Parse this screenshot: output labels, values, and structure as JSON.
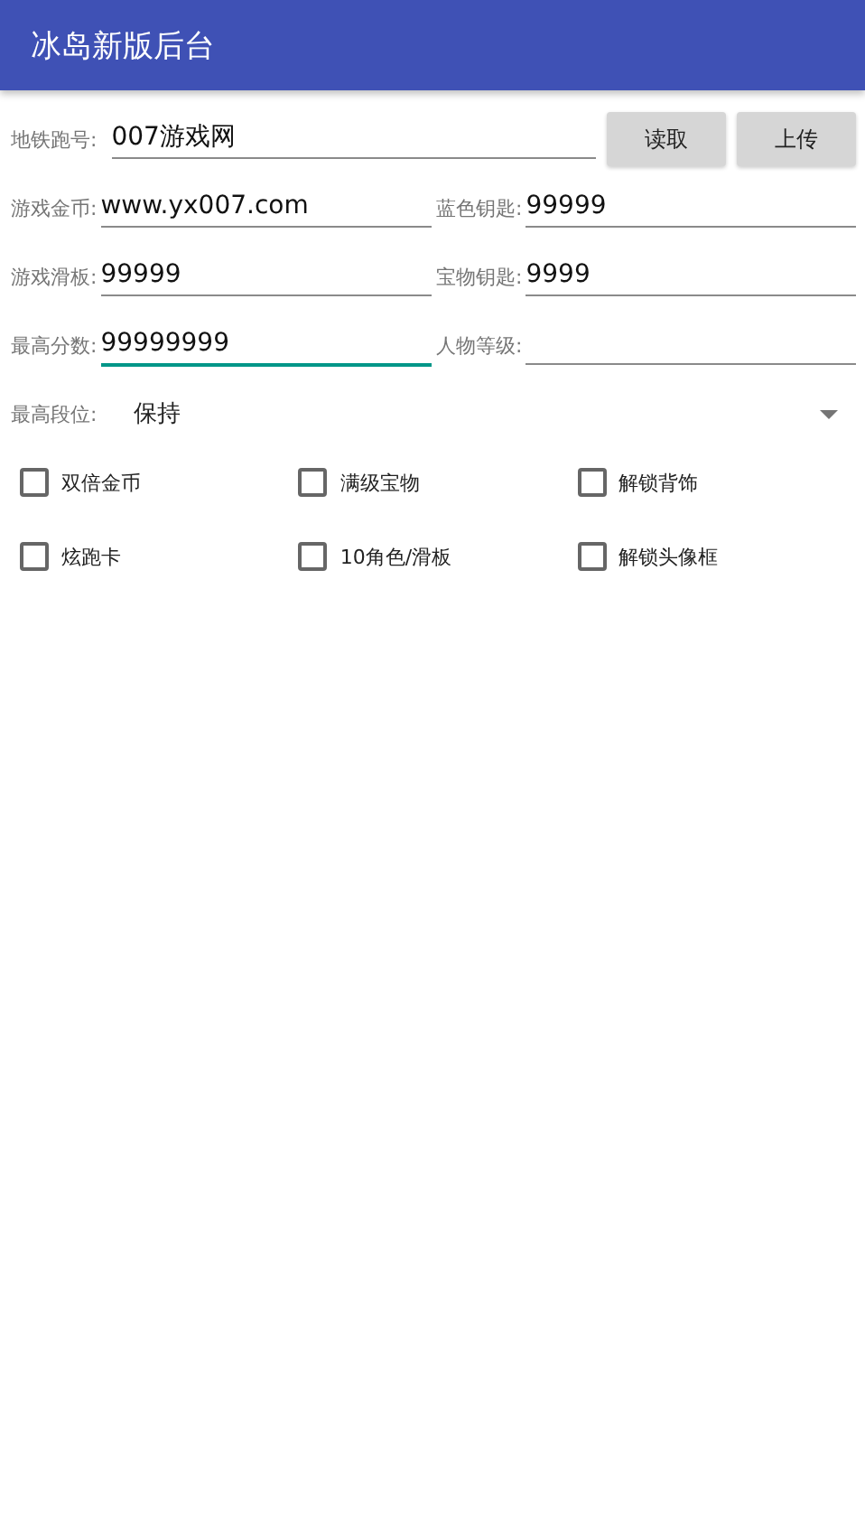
{
  "app_bar": {
    "title": "冰岛新版后台"
  },
  "top_field": {
    "label": "地铁跑号:",
    "value": "007游戏网",
    "focused": false
  },
  "buttons": [
    {
      "label": "读取"
    },
    {
      "label": "上传"
    }
  ],
  "fields": [
    {
      "label": "游戏金币:",
      "value": "www.yx007.com",
      "focused": false
    },
    {
      "label": "蓝色钥匙:",
      "value": "99999",
      "focused": false
    },
    {
      "label": "游戏滑板:",
      "value": "99999",
      "focused": false
    },
    {
      "label": "宝物钥匙:",
      "value": "9999",
      "focused": false
    },
    {
      "label": "最高分数:",
      "value": "99999999",
      "focused": true
    },
    {
      "label": "人物等级:",
      "focused": false
    }
  ],
  "rank": {
    "label": "最高段位:",
    "value": "保持"
  },
  "options": [
    {
      "label": "双倍金币",
      "checked": false
    },
    {
      "label": "满级宝物",
      "checked": false
    },
    {
      "label": "解锁背饰",
      "checked": false
    },
    {
      "label": "炫跑卡",
      "checked": false
    },
    {
      "label": "10角色/滑板",
      "checked": false
    },
    {
      "label": "解锁头像框",
      "checked": false
    }
  ]
}
